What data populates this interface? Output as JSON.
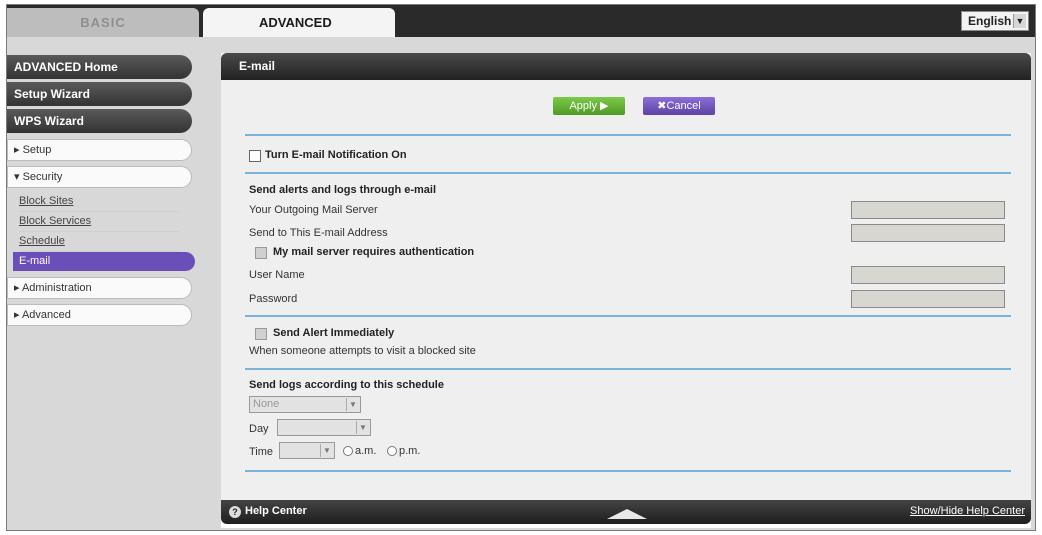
{
  "tabs": {
    "basic": "BASIC",
    "advanced": "ADVANCED"
  },
  "language": {
    "selected": "English"
  },
  "sidebar": {
    "dark_items": [
      "ADVANCED Home",
      "Setup Wizard",
      "WPS Wizard"
    ],
    "setup": "▸ Setup",
    "security": "▾ Security",
    "security_items": [
      "Block Sites",
      "Block Services",
      "Schedule",
      "E-mail"
    ],
    "administration": "▸ Administration",
    "advanced": "▸ Advanced"
  },
  "panel": {
    "title": "E-mail",
    "apply_label": "Apply ▶",
    "cancel_label": "✖Cancel",
    "turn_on_label": "Turn E-mail Notification On",
    "send_alerts_heading": "Send alerts and logs through e-mail",
    "outgoing_server_label": "Your Outgoing Mail Server",
    "send_to_label": "Send to This E-mail Address",
    "auth_label": "My mail server requires authentication",
    "username_label": "User Name",
    "password_label": "Password",
    "alert_immediately_label": "Send Alert Immediately",
    "alert_desc": "When someone attempts to visit a blocked site",
    "schedule_heading": "Send logs according to this schedule",
    "schedule_value": "None",
    "day_label": "Day",
    "time_label": "Time",
    "am_label": "a.m.",
    "pm_label": "p.m."
  },
  "footer": {
    "help_center": "Help Center",
    "show_hide": "Show/Hide Help Center"
  }
}
